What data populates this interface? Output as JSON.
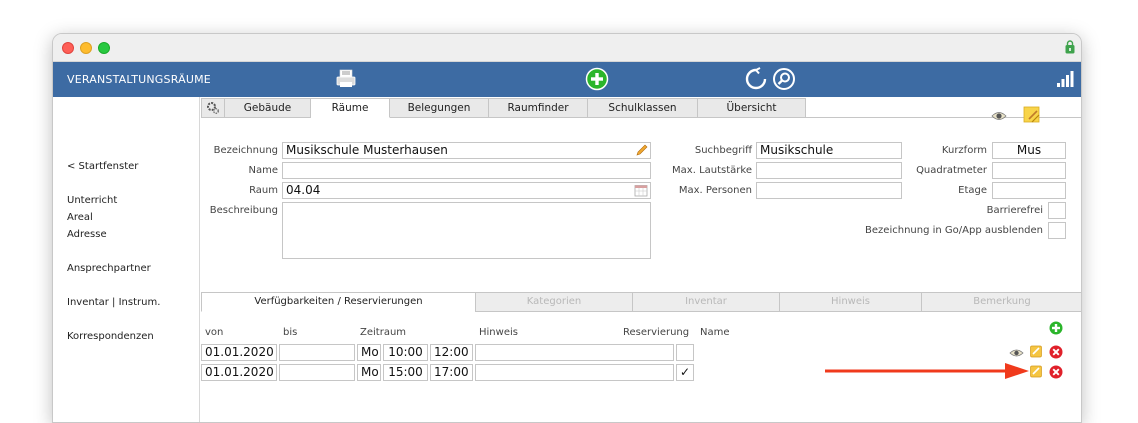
{
  "app": {
    "title": "VERANSTALTUNGSRÄUME"
  },
  "colors": {
    "header": "#3d6ba3",
    "add_green": "#2bb52b",
    "delete_red": "#e0202a",
    "arrow_red": "#f03a1c"
  },
  "icons": {
    "print": "printer-icon",
    "add": "plus-circle-icon",
    "refresh": "refresh-icon",
    "search": "search-icon",
    "signal": "signal-bars-icon"
  },
  "sidebar": {
    "back": "< Startfenster",
    "items": [
      "Unterricht",
      "Areal",
      "Adresse",
      "Ansprechpartner",
      "Inventar | Instrum.",
      "Korrespondenzen"
    ]
  },
  "tabs": [
    "Gebäude",
    "Räume",
    "Belegungen",
    "Raumfinder",
    "Schulklassen",
    "Übersicht"
  ],
  "form": {
    "bezeichnung": {
      "label": "Bezeichnung",
      "value": "Musikschule Musterhausen"
    },
    "name": {
      "label": "Name",
      "value": ""
    },
    "raum": {
      "label": "Raum",
      "value": "04.04"
    },
    "beschreibung": {
      "label": "Beschreibung",
      "value": ""
    },
    "suchbegriff": {
      "label": "Suchbegriff",
      "value": "Musikschule"
    },
    "max_lautstaerke": {
      "label": "Max. Lautstärke",
      "value": ""
    },
    "max_personen": {
      "label": "Max. Personen",
      "value": ""
    },
    "kurzform": {
      "label": "Kurzform",
      "value": "Mus"
    },
    "quadratmeter": {
      "label": "Quadratmeter",
      "value": ""
    },
    "etage": {
      "label": "Etage",
      "value": ""
    },
    "barrierefrei": {
      "label": "Barrierefrei"
    },
    "go_app": {
      "label": "Bezeichnung in Go/App ausblenden"
    }
  },
  "bottom_tabs": [
    "Verfügbarkeiten / Reservierungen",
    "Kategorien",
    "Inventar",
    "Hinweis",
    "Bemerkung"
  ],
  "table": {
    "columns": {
      "von": "von",
      "bis": "bis",
      "zeitraum": "Zeitraum",
      "hinweis": "Hinweis",
      "reservierung": "Reservierung",
      "name": "Name"
    },
    "rows": [
      {
        "von": "01.01.2020",
        "bis": "",
        "tag": "Mo",
        "start": "10:00",
        "ende": "12:00",
        "hinweis": "",
        "reservierung": ""
      },
      {
        "von": "01.01.2020",
        "bis": "",
        "tag": "Mo",
        "start": "15:00",
        "ende": "17:00",
        "hinweis": "",
        "reservierung": "✓"
      }
    ]
  }
}
